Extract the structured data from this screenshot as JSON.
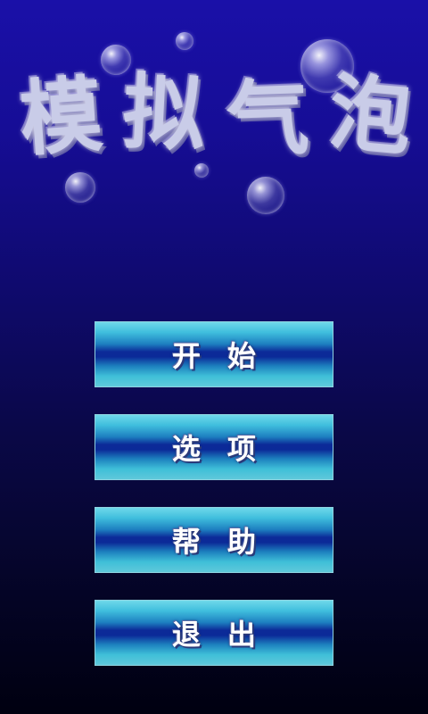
{
  "title": {
    "chars": [
      "模",
      "拟",
      "气",
      "泡"
    ]
  },
  "menu": {
    "start": "开始",
    "options": "选项",
    "help": "帮助",
    "exit": "退出"
  },
  "colors": {
    "background_top": "#1a10a8",
    "background_bottom": "#000010",
    "button_light": "#6fd8ea",
    "button_dark": "#0c2a98",
    "title_text": "#c9cce8"
  }
}
